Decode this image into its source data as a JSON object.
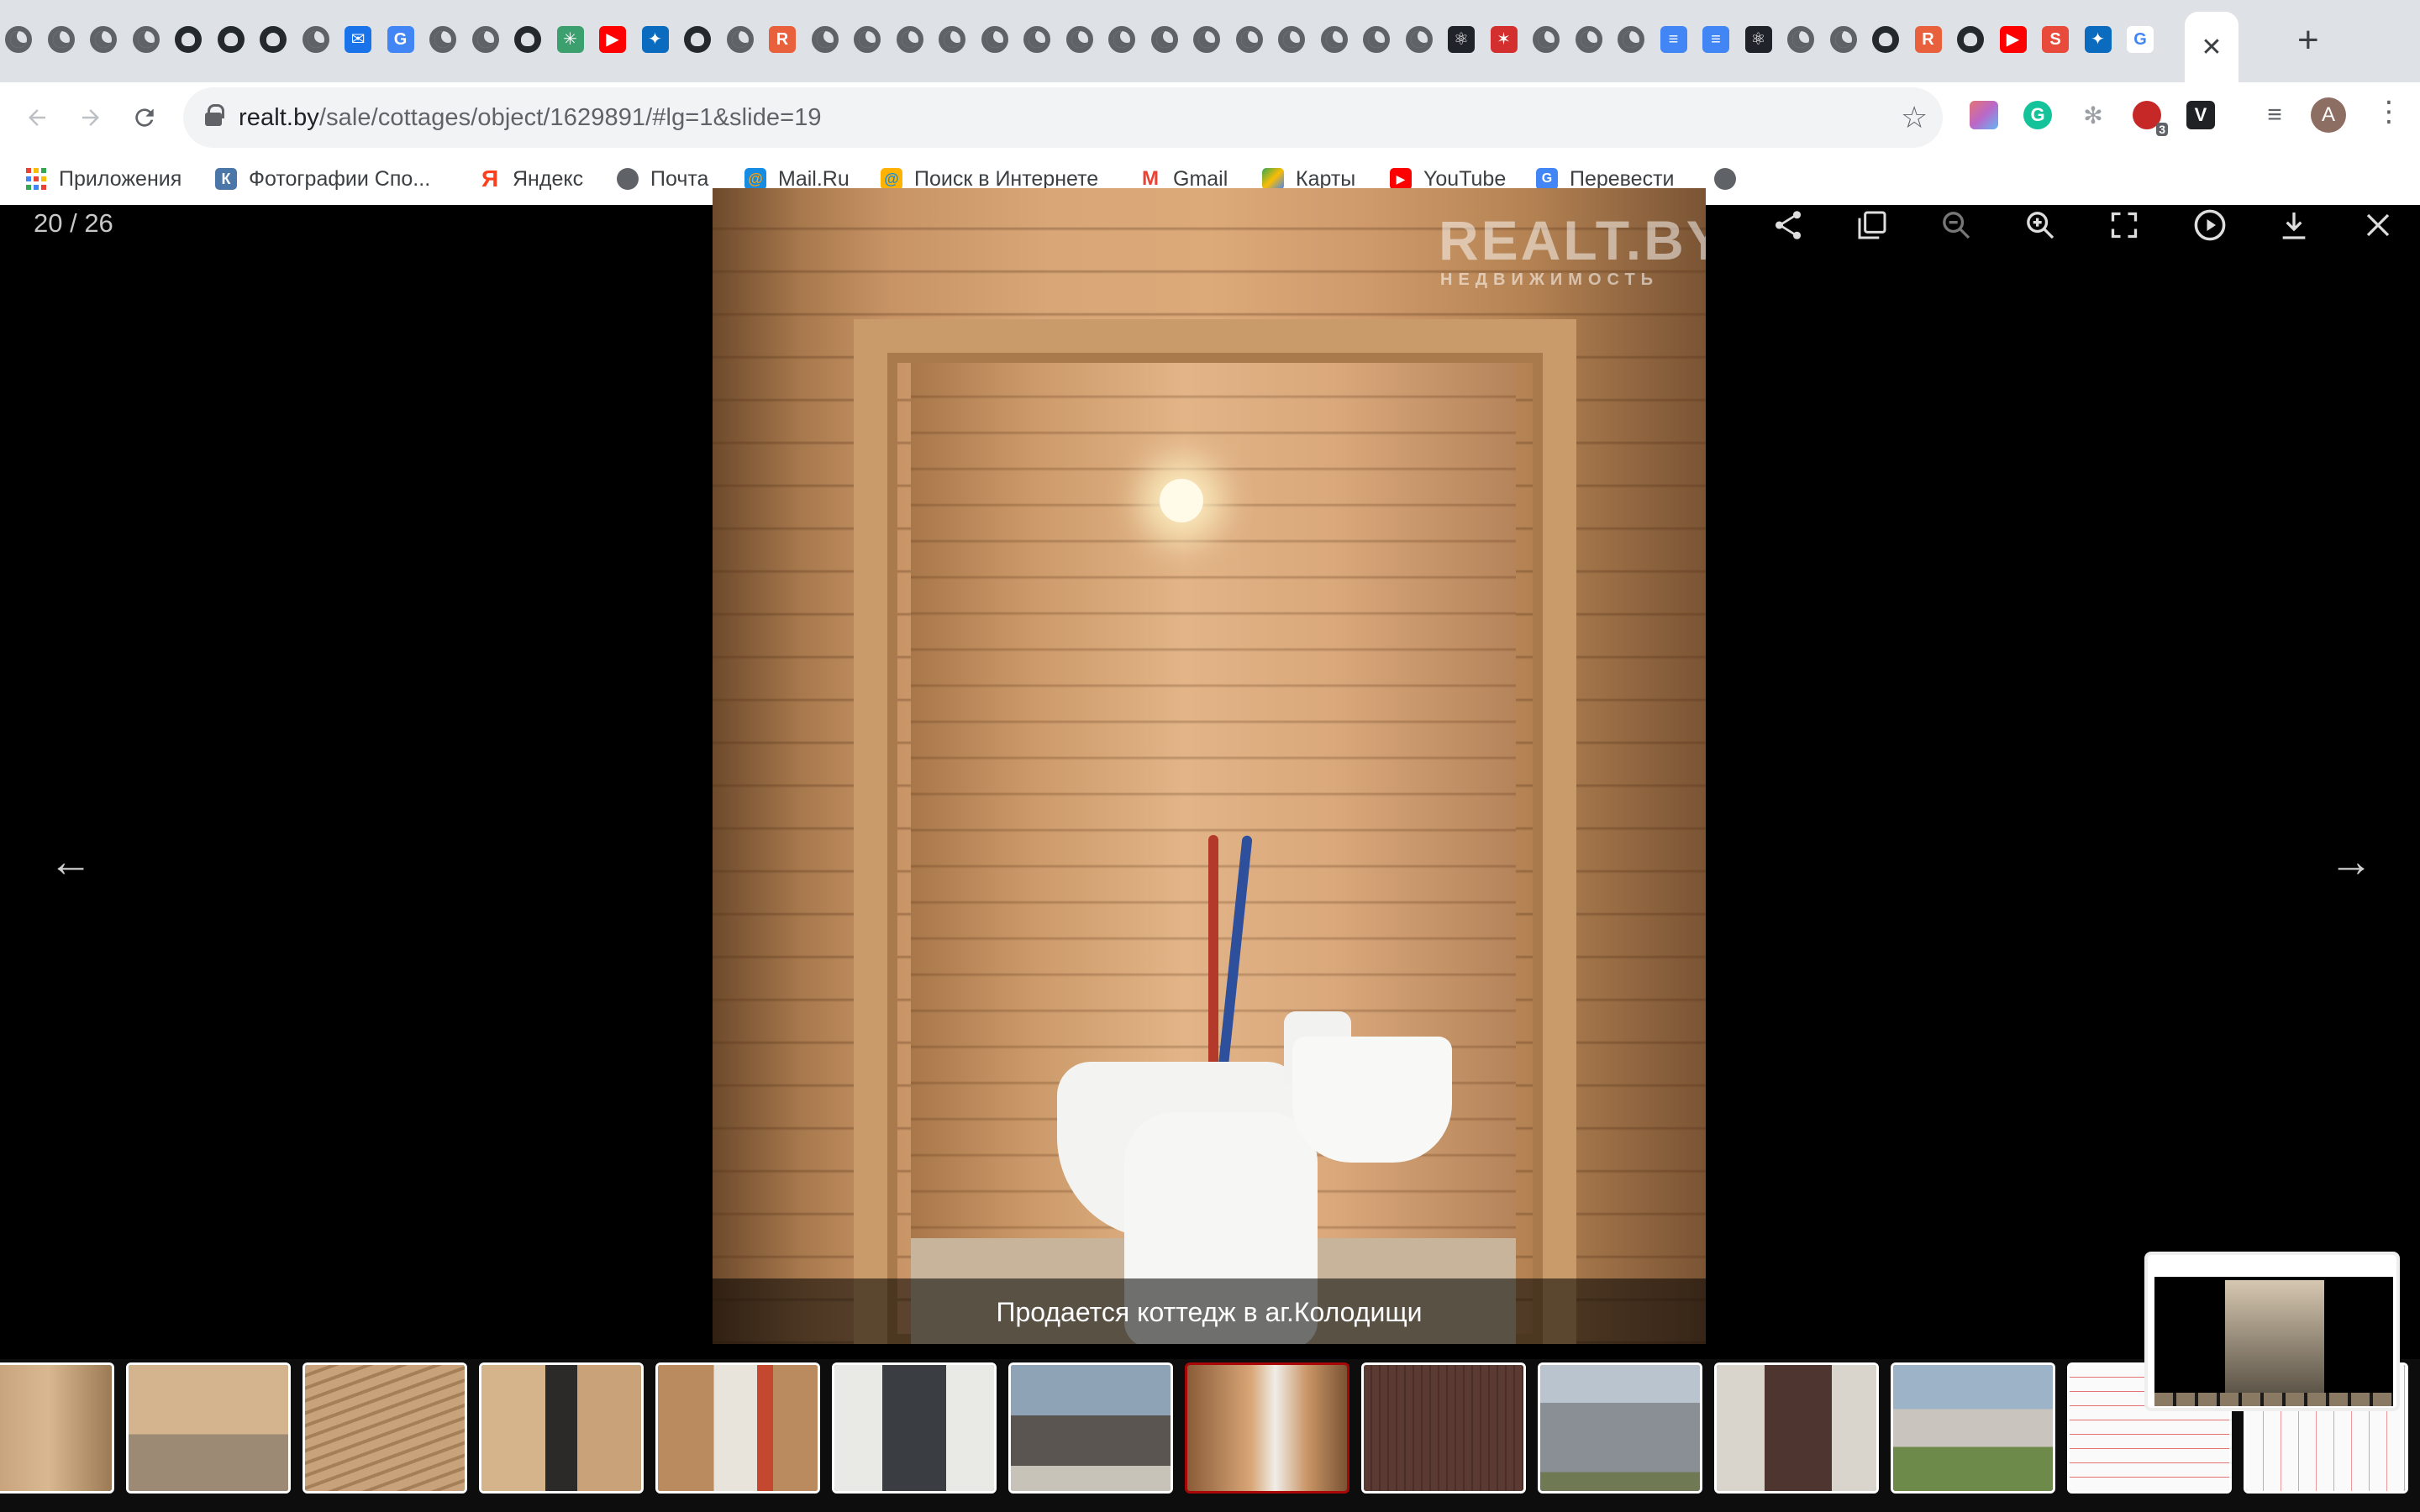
{
  "browser": {
    "active_tab_close": "✕",
    "new_tab": "+",
    "url_host": "realt.by",
    "url_path": "/sale/cottages/object/1629891/#lg=1&slide=19",
    "extension_badge": "3",
    "avatar_letter": "A",
    "bookmarks": [
      {
        "label": "Приложения",
        "icon": "apps-grid-icon"
      },
      {
        "label": "Фотографии Спо...",
        "icon": "vk-icon"
      },
      {
        "label": "Яндекс",
        "icon": "yandex-icon"
      },
      {
        "label": "Почта",
        "icon": "globe-icon"
      },
      {
        "label": "Mail.Ru",
        "icon": "mailru-icon"
      },
      {
        "label": "Поиск в Интернете",
        "icon": "search-globe-icon"
      },
      {
        "label": "Gmail",
        "icon": "gmail-icon"
      },
      {
        "label": "Карты",
        "icon": "maps-icon"
      },
      {
        "label": "YouTube",
        "icon": "youtube-icon"
      },
      {
        "label": "Перевести",
        "icon": "translate-icon"
      }
    ]
  },
  "viewer": {
    "counter": "20 / 26",
    "caption": "Продается коттедж в аг.Колодищи",
    "watermark_title": "REALT.BY",
    "watermark_subtitle": "НЕДВИЖИМОСТЬ",
    "tools": [
      "share-icon",
      "thumbnails-icon",
      "zoom-out-icon",
      "zoom-in-icon",
      "fullscreen-icon",
      "autoplay-icon",
      "download-icon",
      "close-icon"
    ],
    "prev_arrow": "←",
    "next_arrow": "→",
    "accent_active_thumb": "#a90707"
  },
  "thumbnails": [
    {
      "scene": "wood-interior-left"
    },
    {
      "scene": "room-with-window"
    },
    {
      "scene": "wood-ceiling-room"
    },
    {
      "scene": "room-doorway"
    },
    {
      "scene": "boiler-room"
    },
    {
      "scene": "white-wall-window"
    },
    {
      "scene": "terrace"
    },
    {
      "scene": "bathroom",
      "active": true
    },
    {
      "scene": "brown-fence"
    },
    {
      "scene": "fence-gate"
    },
    {
      "scene": "brown-gate"
    },
    {
      "scene": "house-exterior"
    },
    {
      "scene": "floor-plan"
    },
    {
      "scene": "floor-plan-2"
    }
  ]
}
